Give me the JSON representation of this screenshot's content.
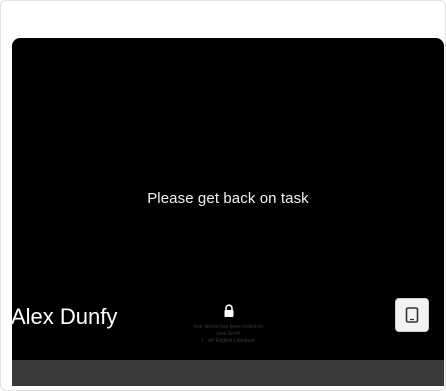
{
  "tile": {
    "student_name": "Alex Dunfy",
    "screen": {
      "message": "Please get back on task",
      "lock_line_1": "Your device has been locked by",
      "lock_line_2": "Jane Smith",
      "lock_line_3": "1 · AP English Literature"
    },
    "icons": {
      "lock": "lock-icon",
      "device": "tablet-icon"
    }
  }
}
